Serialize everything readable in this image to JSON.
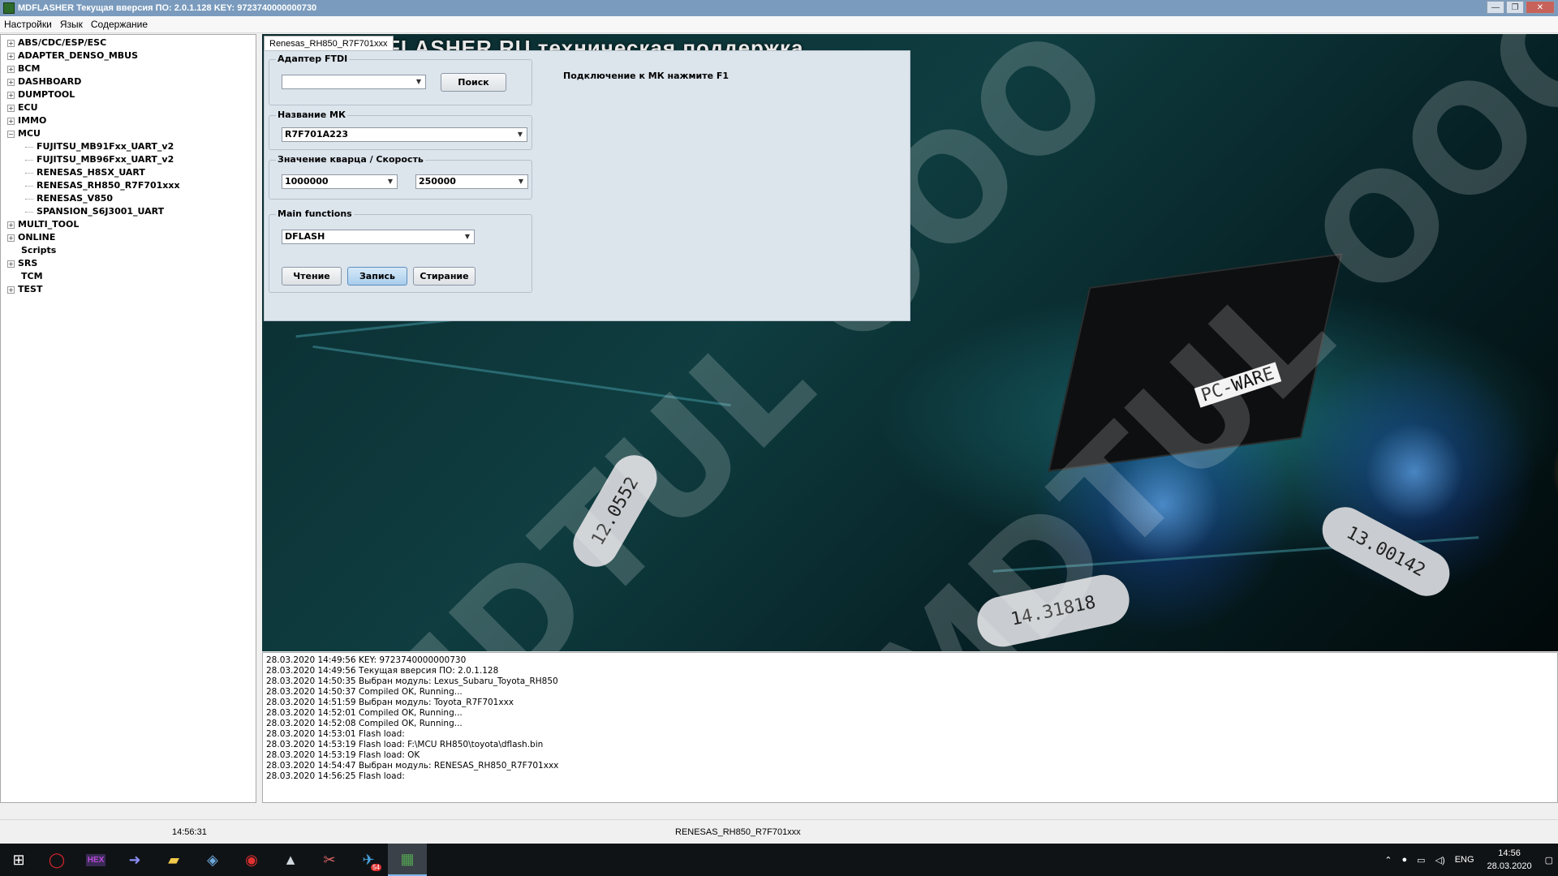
{
  "window": {
    "title": "MDFLASHER  Текущая вверсия ПО: 2.0.1.128  KEY: 9723740000000730",
    "controls": [
      "—",
      "❐",
      "✕"
    ]
  },
  "menu": [
    "Настройки",
    "Язык",
    "Содержание"
  ],
  "tree": {
    "roots_before": [
      "ABS/CDC/ESP/ESC",
      "ADAPTER_DENSO_MBUS",
      "BCM",
      "DASHBOARD",
      "DUMPTOOL",
      "ECU",
      "IMMO"
    ],
    "expanded": {
      "label": "MCU",
      "children": [
        "FUJITSU_MB91Fxx_UART_v2",
        "FUJITSU_MB96Fxx_UART_v2",
        "RENESAS_H8SX_UART",
        "RENESAS_RH850_R7F701xxx",
        "RENESAS_V850",
        "SPANSION_S6J3001_UART"
      ]
    },
    "roots_after": [
      {
        "label": "MULTI_TOOL",
        "expandable": true
      },
      {
        "label": "ONLINE",
        "expandable": true
      },
      {
        "label": "Scripts",
        "expandable": false
      },
      {
        "label": "SRS",
        "expandable": true
      },
      {
        "label": "TCM",
        "expandable": false
      },
      {
        "label": "TEST",
        "expandable": true
      }
    ]
  },
  "tab": {
    "label": "Renesas_RH850_R7F701xxx"
  },
  "background_heading": "FLASHER.RU техническая поддержка",
  "panel": {
    "adapter": {
      "legend": "Адаптер FTDI",
      "value": "",
      "search_label": "Поиск"
    },
    "mcu": {
      "legend": "Название МК",
      "value": "R7F701A223"
    },
    "quartz": {
      "legend": "Значение кварца / Скорость",
      "crystal": "1000000",
      "speed": "250000"
    },
    "functions": {
      "legend": "Main functions",
      "value": "DFLASH",
      "read_label": "Чтение",
      "write_label": "Запись",
      "erase_label": "Стирание"
    },
    "hint": "Подключение к МК нажмите F1"
  },
  "background_marks": {
    "chip_label": "PC-WARE",
    "crystal_1": "14.31818",
    "crystal_2": "13.00142",
    "crystal_3": "12.0552"
  },
  "log": [
    "28.03.2020 14:49:56  KEY: 9723740000000730",
    "28.03.2020 14:49:56  Текущая вверсия ПО: 2.0.1.128",
    "28.03.2020 14:50:35  Выбран модуль:  Lexus_Subaru_Toyota_RH850",
    "28.03.2020 14:50:37  Compiled OK, Running...",
    "28.03.2020 14:51:59  Выбран модуль:  Toyota_R7F701xxx",
    "28.03.2020 14:52:01  Compiled OK, Running...",
    "28.03.2020 14:52:08  Compiled OK, Running...",
    "28.03.2020 14:53:01  Flash load:",
    "28.03.2020 14:53:19  Flash load:  F:\\MCU RH850\\toyota\\dflash.bin",
    "28.03.2020 14:53:19  Flash load:  OK",
    "28.03.2020 14:54:47  Выбран модуль:  RENESAS_RH850_R7F701xxx",
    "28.03.2020 14:56:25  Flash load:"
  ],
  "statusbar": {
    "time": "14:56:31",
    "module": "RENESAS_RH850_R7F701xxx"
  },
  "taskbar": {
    "apps": [
      {
        "name": "opera-icon",
        "glyph": "◯",
        "color": "#e0262d"
      },
      {
        "name": "hex-editor-icon",
        "glyph": "HEX",
        "color": "#b84bd6"
      },
      {
        "name": "arrow-app-icon",
        "glyph": "➜",
        "color": "#8a8df2"
      },
      {
        "name": "file-explorer-icon",
        "glyph": "▰",
        "color": "#f2c94c"
      },
      {
        "name": "tool-app-icon",
        "glyph": "◈",
        "color": "#6fa8dc"
      },
      {
        "name": "record-app-icon",
        "glyph": "◉",
        "color": "#e03131"
      },
      {
        "name": "photos-icon",
        "glyph": "▲",
        "color": "#cfd8dc"
      },
      {
        "name": "snipping-icon",
        "glyph": "✂",
        "color": "#e06666"
      },
      {
        "name": "telegram-icon",
        "glyph": "✈",
        "color": "#4aa3df",
        "badge": "54"
      },
      {
        "name": "mdflasher-icon",
        "glyph": "▦",
        "color": "#53a653"
      }
    ],
    "language": "ENG",
    "clock_time": "14:56",
    "clock_date": "28.03.2020"
  },
  "watermark_text": "MDTUL OOO"
}
